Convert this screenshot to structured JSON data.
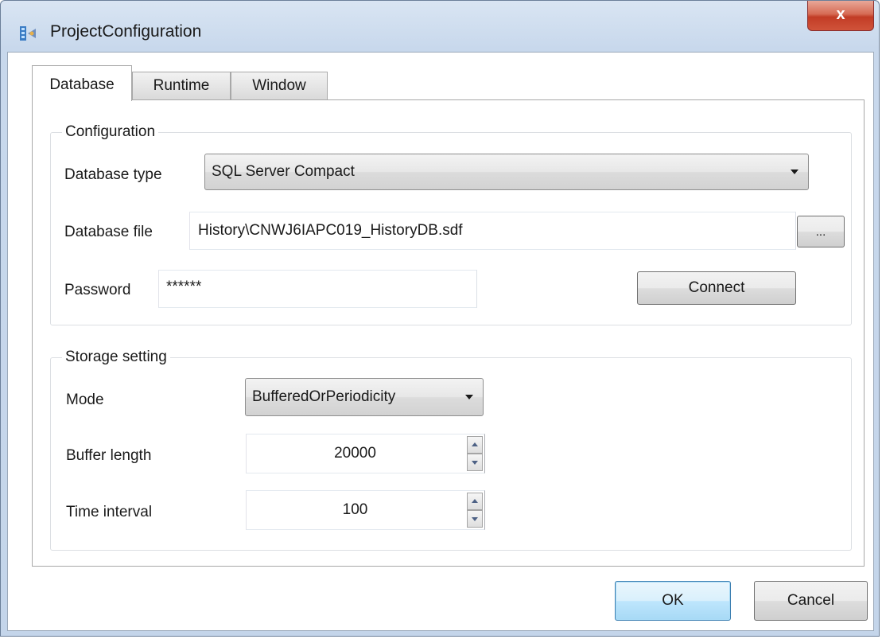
{
  "window": {
    "title": "ProjectConfiguration",
    "close_label": "x"
  },
  "tabs": [
    {
      "label": "Database",
      "active": true
    },
    {
      "label": "Runtime",
      "active": false
    },
    {
      "label": "Window",
      "active": false
    }
  ],
  "configuration": {
    "group_title": "Configuration",
    "database_type_label": "Database type",
    "database_type_value": "SQL Server Compact",
    "database_file_label": "Database file",
    "database_file_value": "History\\CNWJ6IAPC019_HistoryDB.sdf",
    "browse_label": "...",
    "password_label": "Password",
    "password_value": "******",
    "connect_label": "Connect"
  },
  "storage": {
    "group_title": "Storage setting",
    "mode_label": "Mode",
    "mode_value": "BufferedOrPeriodicity",
    "buffer_length_label": "Buffer length",
    "buffer_length_value": "20000",
    "time_interval_label": "Time interval",
    "time_interval_value": "100"
  },
  "buttons": {
    "ok_label": "OK",
    "cancel_label": "Cancel"
  }
}
